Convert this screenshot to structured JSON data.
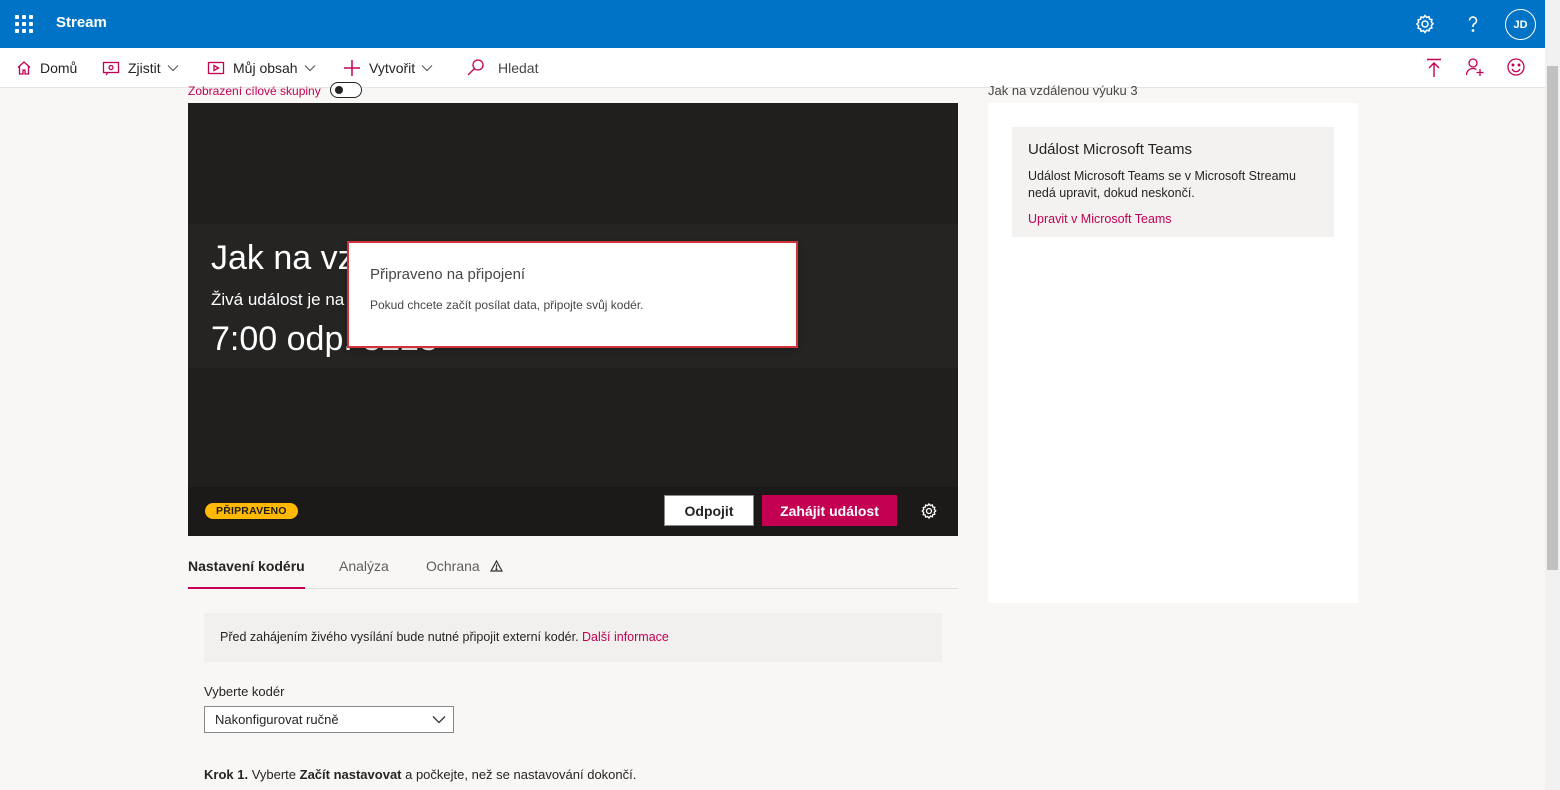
{
  "app": {
    "name": "Stream",
    "user_initials": "JD"
  },
  "colors": {
    "brand_blue": "#0173c7",
    "accent_magenta": "#c30052",
    "badge_yellow": "#ffb900",
    "dialog_border": "#d13438"
  },
  "nav": {
    "home": "Domů",
    "discover": "Zjistit",
    "my_content": "Můj obsah",
    "create": "Vytvořit",
    "search": "Hledat"
  },
  "top_icons": [
    "gear-icon",
    "help-icon"
  ],
  "nav_right_icons": [
    "upload-icon",
    "invite-user-icon",
    "feedback-smiley-icon"
  ],
  "event": {
    "audience_view_label": "Zobrazení cílové skupiny",
    "right_header": "Jak na vzdálenou výuku 3",
    "slate_title": "Jak na vz",
    "slate_subtitle": "Živá událost je na",
    "slate_time": "7:00 odp. 3223",
    "status_badge": "PŘIPRAVENO",
    "disconnect_label": "Odpojit",
    "start_label": "Zahájit událost"
  },
  "dialog": {
    "title": "Připraveno na připojení",
    "text": "Pokud chcete začít posílat data, připojte svůj kodér."
  },
  "tabs": [
    {
      "label": "Nastavení kodéru",
      "active": true
    },
    {
      "label": "Analýza",
      "active": false
    },
    {
      "label": "Ochrana",
      "active": false,
      "icon": "warning-icon"
    }
  ],
  "encoder": {
    "info_text": "Před zahájením živého vysílání bude nutné připojit externí kodér.",
    "info_link": "Další informace",
    "select_label": "Vyberte kodér",
    "select_value": "Nakonfigurovat ručně",
    "step_prefix": "Krok 1.",
    "step_text_1": " Vyberte ",
    "step_bold": "Začít nastavovat",
    "step_text_2": " a počkejte, než se nastavování dokončí."
  },
  "teams_card": {
    "title": "Událost Microsoft Teams",
    "text": "Událost Microsoft Teams se v Microsoft Streamu nedá upravit, dokud neskončí.",
    "link": "Upravit v Microsoft Teams"
  }
}
